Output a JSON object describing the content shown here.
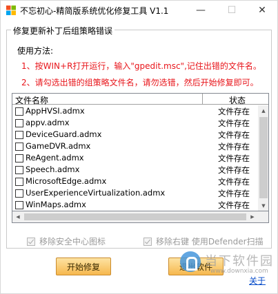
{
  "window": {
    "title": "不忘初心-精简版系统优化修复工具 V1.1",
    "minimize": "—",
    "maximize": "☐",
    "close": "✕"
  },
  "group": {
    "title": "修复更新补丁后组策略错误"
  },
  "instructions": {
    "label": "使用方法:",
    "step1": "1、按WIN+R打开运行，输入\"gpedit.msc\",记住出错的文件名。",
    "step2": "2、请勾选出错的组策略文件名，请勿选错，然后开始修复即可。"
  },
  "list": {
    "columns": [
      "文件名称",
      "状态"
    ],
    "rows": [
      {
        "name": "AppHVSI.admx",
        "status": "文件存在"
      },
      {
        "name": "appv.admx",
        "status": "文件存在"
      },
      {
        "name": "DeviceGuard.admx",
        "status": "文件存在"
      },
      {
        "name": "GameDVR.admx",
        "status": "文件存在"
      },
      {
        "name": "ReAgent.admx",
        "status": "文件存在"
      },
      {
        "name": "Speech.admx",
        "status": "文件存在"
      },
      {
        "name": "MicrosoftEdge.admx",
        "status": "文件存在"
      },
      {
        "name": "UserExperienceVirtualization.admx",
        "status": "文件存在"
      },
      {
        "name": "WinMaps.admx",
        "status": "文件存在"
      }
    ]
  },
  "options": {
    "remove_security_icon": "移除安全中心图标",
    "remove_defender_menu": "移除右键 使用Defender扫描"
  },
  "buttons": {
    "start": "开始修复",
    "exit": "退出软件"
  },
  "about": "关于",
  "watermark": {
    "text": "当下软件园",
    "url": "www.downxia.com"
  },
  "icons": {
    "app": "windows-logo-icon",
    "minimize": "minimize-icon",
    "maximize": "maximize-icon",
    "close": "close-icon"
  }
}
